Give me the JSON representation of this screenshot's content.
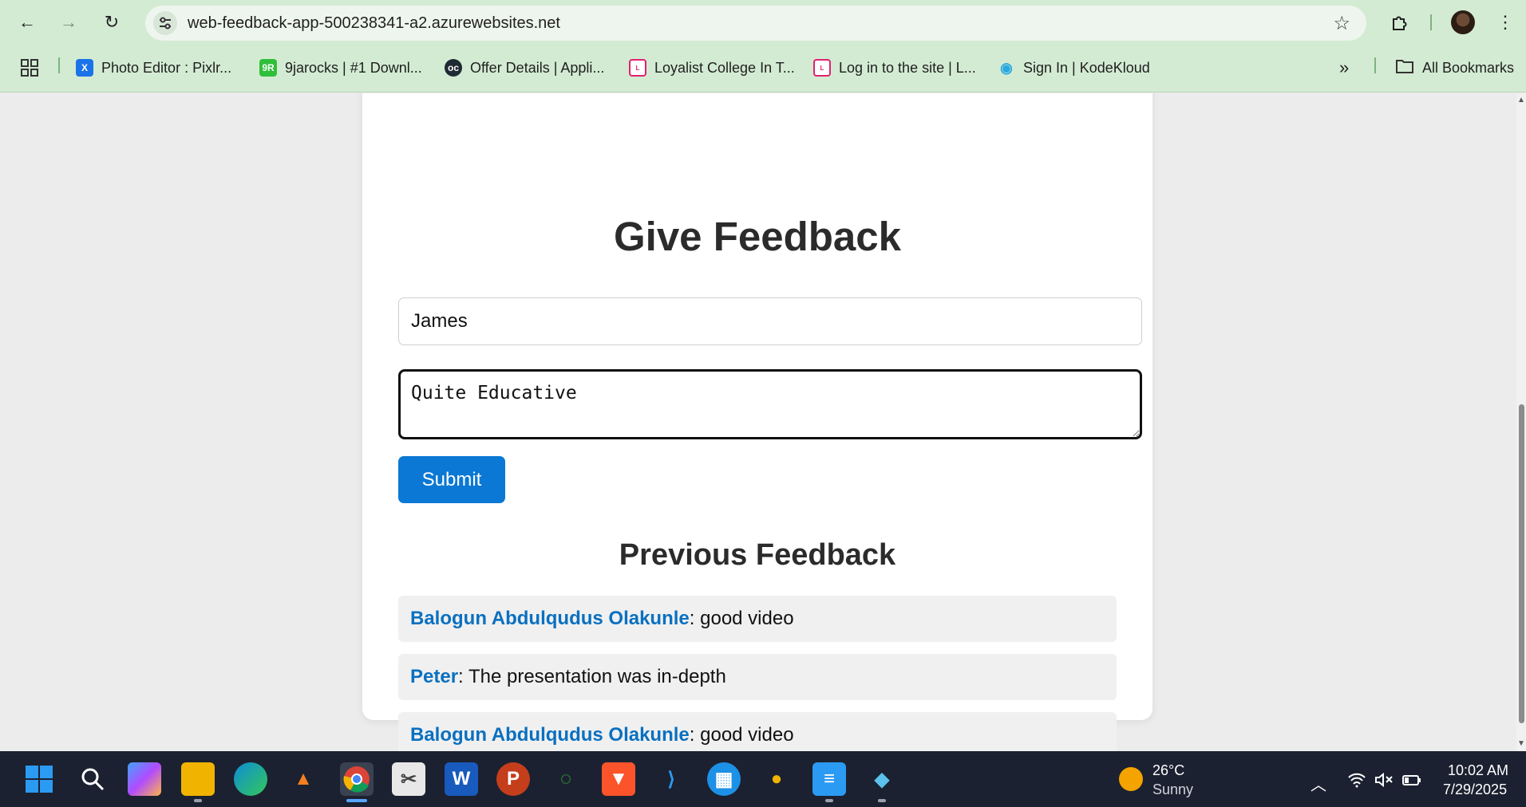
{
  "browser": {
    "url": "web-feedback-app-500238341-a2.azurewebsites.net",
    "bookmarks": [
      {
        "label": "Photo Editor : Pixlr...",
        "icon": "pixlr-icon",
        "color": "#1a73e8"
      },
      {
        "label": "9jarocks | #1 Downl...",
        "icon": "9jarocks-icon",
        "color": "#2fbf3a"
      },
      {
        "label": "Offer Details | Appli...",
        "icon": "oc-icon",
        "color": "#1f2a33"
      },
      {
        "label": "Loyalist College In T...",
        "icon": "loyalist-icon",
        "color": "#e0226e"
      },
      {
        "label": "Log in to the site | L...",
        "icon": "loyalist-icon",
        "color": "#e0226e"
      },
      {
        "label": "Sign In | KodeKloud",
        "icon": "kodekloud-icon",
        "color": "#2aa9e0"
      }
    ],
    "all_bookmarks": "All Bookmarks"
  },
  "form": {
    "title": "Give Feedback",
    "name_value": "James",
    "comment_value": "Quite Educative",
    "submit_label": "Submit"
  },
  "feedback": {
    "title": "Previous Feedback",
    "items": [
      {
        "name": "Balogun Abdulqudus Olakunle",
        "text": ": good video"
      },
      {
        "name": "Peter",
        "text": ": The presentation was in-depth"
      },
      {
        "name": "Balogun Abdulqudus Olakunle",
        "text": ": good video"
      }
    ]
  },
  "taskbar": {
    "weather_temp": "26°C",
    "weather_desc": "Sunny",
    "time": "10:02 AM",
    "date": "7/29/2025"
  }
}
